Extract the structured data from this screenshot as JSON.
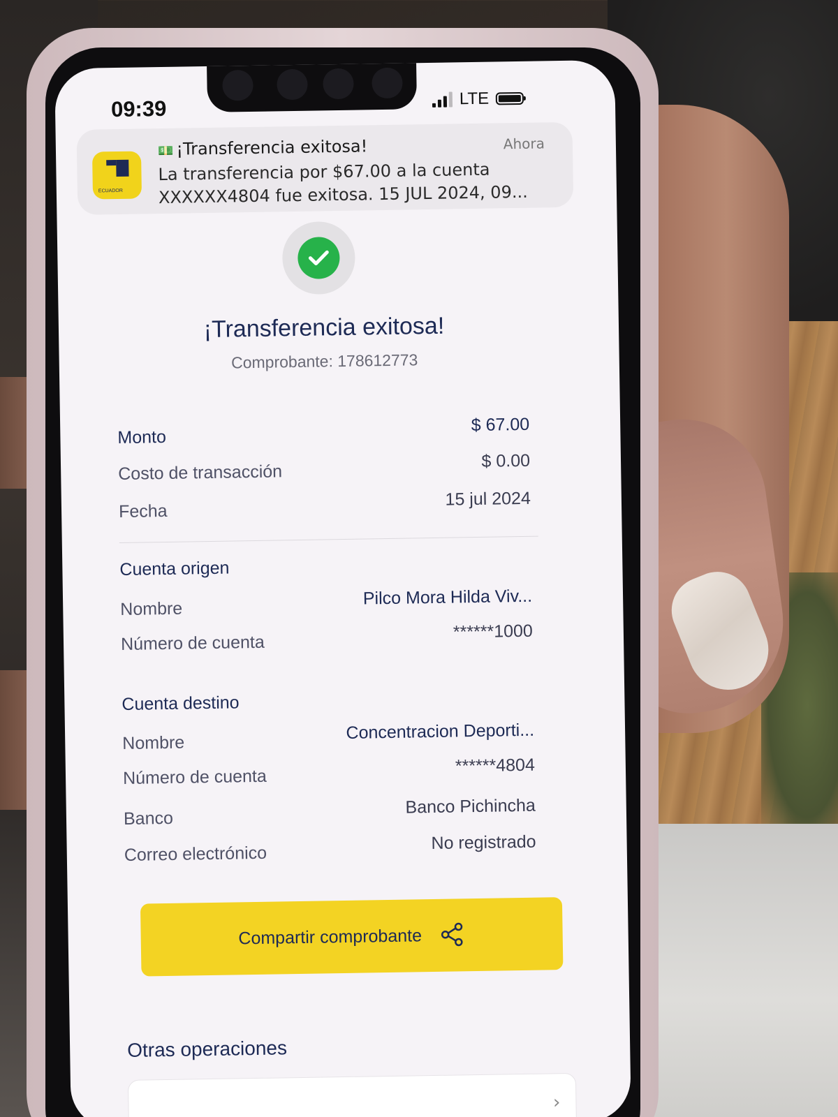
{
  "status_bar": {
    "time": "09:39",
    "network": "LTE"
  },
  "notification": {
    "app_badge": "ECUADOR",
    "title": "¡Transferencia exitosa!",
    "time": "Ahora",
    "body": "La transferencia por $67.00 a la cuenta XXXXXX4804 fue exitosa. 15 JUL 2024, 09..."
  },
  "header": {
    "title": "¡Transferencia exitosa!",
    "voucher": "Comprobante: 178612773"
  },
  "summary": {
    "amount_label": "Monto",
    "amount_value": "$ 67.00",
    "cost_label": "Costo de transacción",
    "cost_value": "$ 0.00",
    "date_label": "Fecha",
    "date_value": "15 jul 2024"
  },
  "origin": {
    "heading": "Cuenta origen",
    "name_label": "Nombre",
    "name_value": "Pilco  Mora Hilda Viv...",
    "account_label": "Número de cuenta",
    "account_value": "******1000"
  },
  "destination": {
    "heading": "Cuenta destino",
    "name_label": "Nombre",
    "name_value": "Concentracion Deporti...",
    "account_label": "Número de cuenta",
    "account_value": "******4804",
    "bank_label": "Banco",
    "bank_value": "Banco Pichincha",
    "email_label": "Correo electrónico",
    "email_value": "No registrado"
  },
  "actions": {
    "share_label": "Compartir comprobante"
  },
  "other": {
    "heading": "Otras operaciones"
  },
  "colors": {
    "brand_yellow": "#f3d323",
    "brand_navy": "#1d2a55",
    "success_green": "#27b24a"
  },
  "icons": {
    "success": "check-icon",
    "share": "share-icon",
    "chevron": "chevron-right-icon"
  }
}
